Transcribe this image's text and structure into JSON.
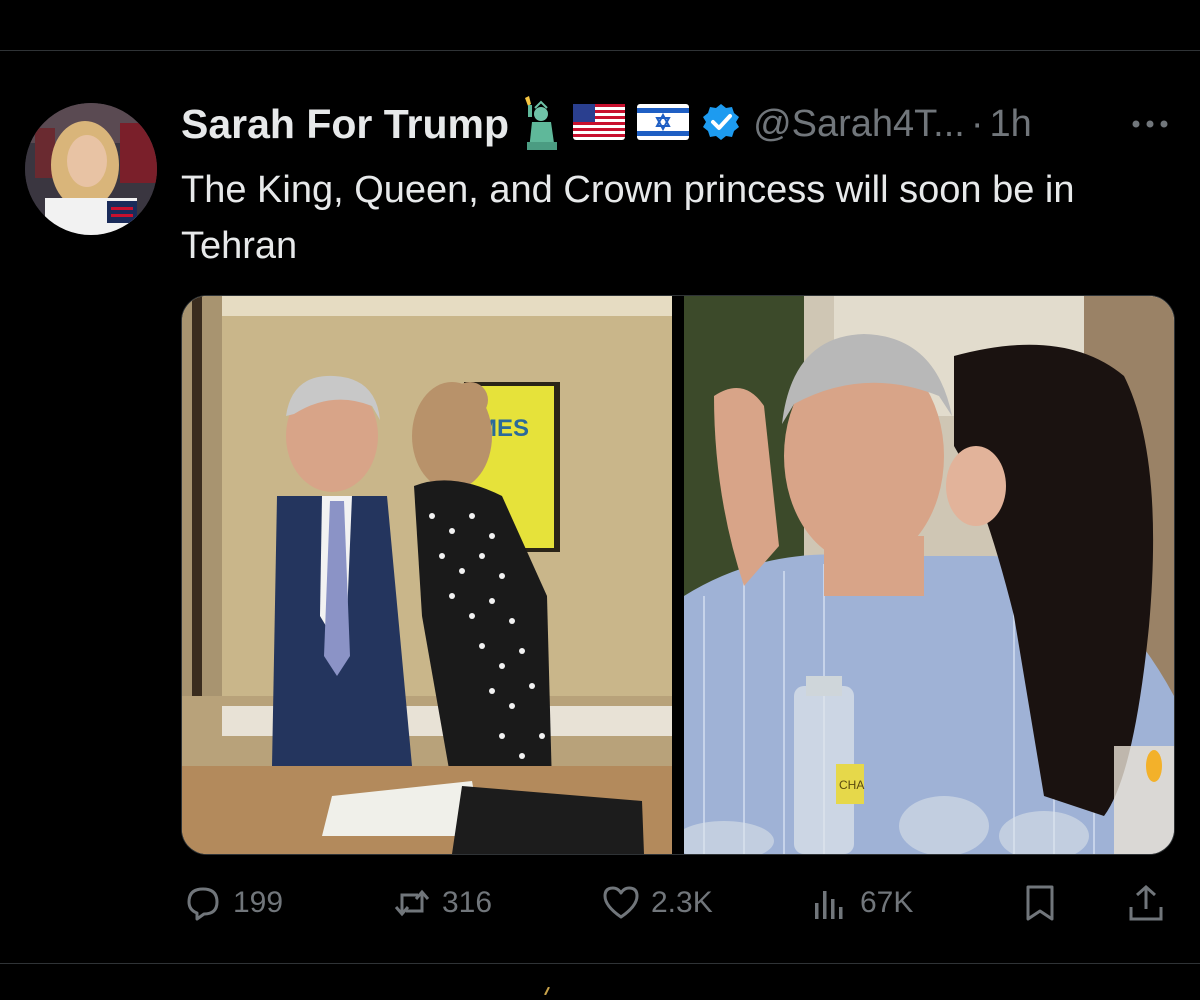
{
  "post": {
    "display_name": "Sarah For Trump",
    "handle": "@Sarah4T...",
    "separator": "·",
    "time": "1h",
    "text": "The King, Queen, and Crown princess will soon be in Tehran",
    "emojis": [
      "statue-of-liberty-emoji",
      "us-flag-emoji",
      "israel-flag-emoji"
    ],
    "verified": true,
    "media": [
      {
        "description_icon": "photo-left",
        "sign_text": "MES"
      },
      {
        "description_icon": "photo-right",
        "label_text": "CHA"
      }
    ]
  },
  "actions": {
    "replies": "199",
    "reposts": "316",
    "likes": "2.3K",
    "views": "67K"
  },
  "colors": {
    "background": "#000000",
    "text": "#e7e9ea",
    "muted": "#71767b",
    "verified_blue": "#1d9bf0",
    "divider": "#2f3336"
  }
}
